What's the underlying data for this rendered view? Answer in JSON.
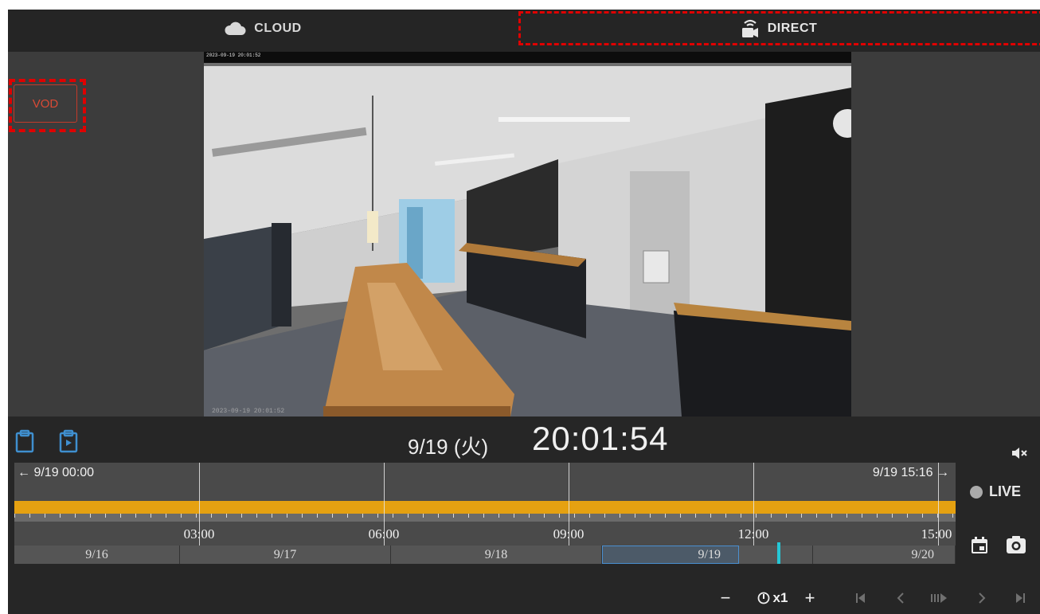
{
  "tabs": {
    "cloud": {
      "label": "CLOUD",
      "icon": "cloud-icon"
    },
    "direct": {
      "label": "DIRECT",
      "icon": "wifi-camera-icon"
    }
  },
  "left_panel": {
    "vod_label": "VOD"
  },
  "video": {
    "overlay_timestamp": "2023-09-19 20:01:52",
    "overlay_bottom_text": "2023-09-19 20:01:52"
  },
  "playback": {
    "date": "9/19 (火)",
    "time": "20:01:54"
  },
  "timeline": {
    "range_start": "← 9/19 00:00",
    "range_end": "9/19 15:16 →",
    "hour_labels": [
      "03:00",
      "06:00",
      "09:00",
      "12:00",
      "15:00"
    ],
    "days": [
      "9/16",
      "9/17",
      "9/18",
      "9/19",
      "9/20"
    ],
    "selected_day": "9/19",
    "recording_color": "#e5a111",
    "playhead_color": "#25c7d6"
  },
  "side_controls": {
    "live_label": "LIVE",
    "icons": [
      "calendar-icon",
      "camera-icon",
      "mute-icon"
    ]
  },
  "playback_controls": {
    "minus": "−",
    "speed": "x1",
    "plus": "+",
    "icons": [
      "skip-start-icon",
      "step-back-icon",
      "play-pause-icon",
      "step-forward-icon",
      "skip-end-icon"
    ]
  },
  "colors": {
    "accent_red": "#e00000",
    "vod_text": "#d94a35"
  }
}
